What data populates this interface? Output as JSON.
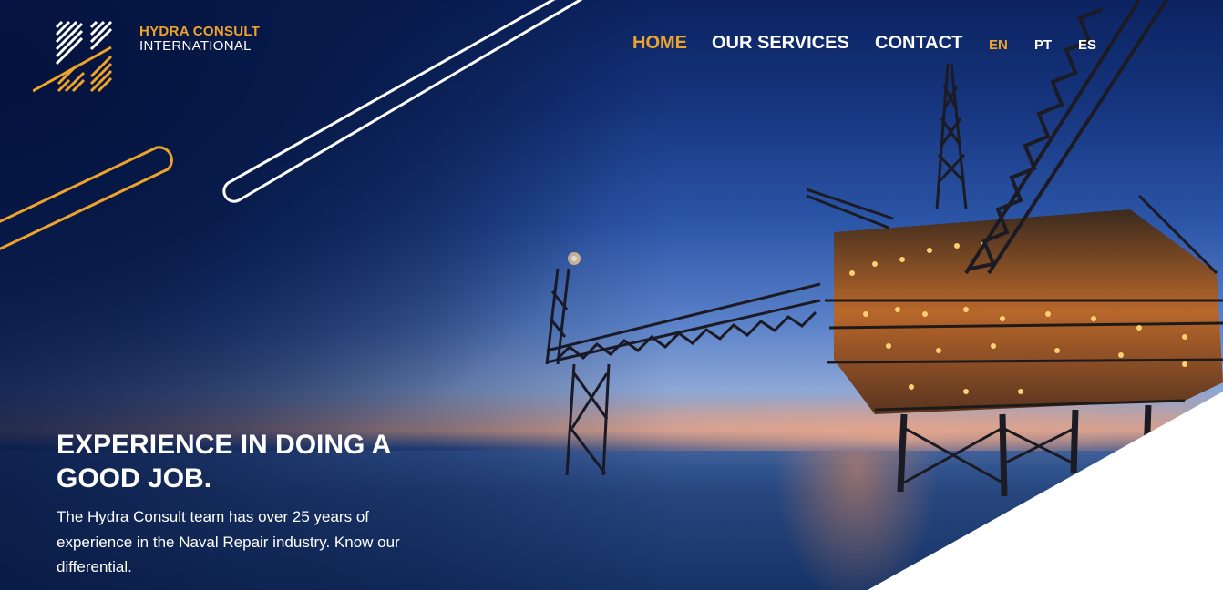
{
  "brand": {
    "name_line1": "HYDRA CONSULT",
    "name_line2": "INTERNATIONAL",
    "accent_color": "#f0a32a",
    "logo_icon": "hydra-h-logo-icon"
  },
  "nav": {
    "items": [
      {
        "label": "HOME",
        "active": true
      },
      {
        "label": "OUR SERVICES",
        "active": false
      },
      {
        "label": "CONTACT",
        "active": false
      }
    ],
    "languages": [
      {
        "label": "EN",
        "active": true
      },
      {
        "label": "PT",
        "active": false
      },
      {
        "label": "ES",
        "active": false
      }
    ]
  },
  "hero": {
    "headline": "EXPERIENCE IN DOING A GOOD JOB.",
    "description": "The Hydra Consult team has over 25 years of experience in the Naval Repair industry. Know our differential."
  }
}
